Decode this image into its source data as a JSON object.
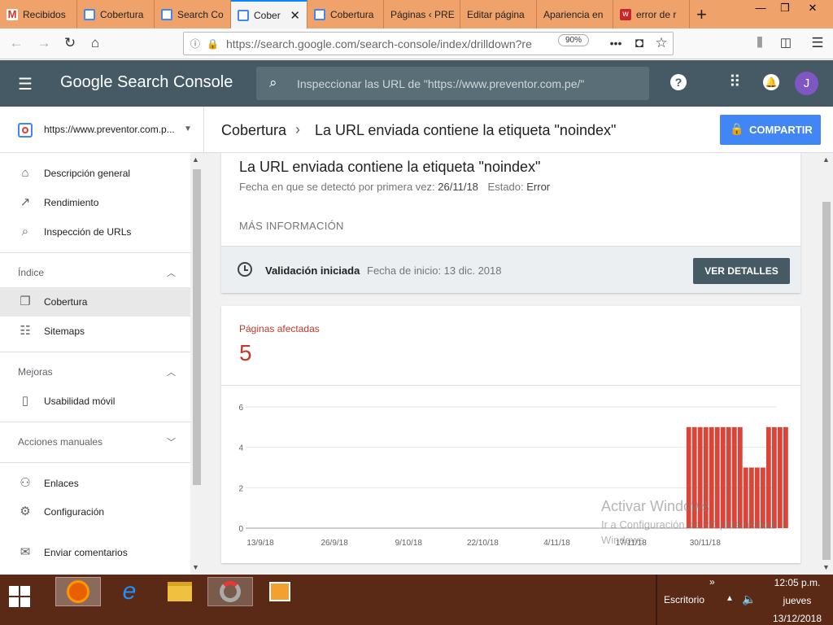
{
  "browser": {
    "tabs": [
      {
        "label": "Recibidos",
        "active": false
      },
      {
        "label": "Cobertura",
        "active": false
      },
      {
        "label": "Search Co",
        "active": false
      },
      {
        "label": "Cober",
        "active": true
      },
      {
        "label": "Cobertura",
        "active": false
      },
      {
        "label": "Páginas ‹ PRE",
        "active": false
      },
      {
        "label": "Editar página",
        "active": false
      },
      {
        "label": "Apariencia en",
        "active": false
      },
      {
        "label": "error de r",
        "active": false
      }
    ],
    "new_tab": "+",
    "url": "https://search.google.com/search-console/index/drilldown?re",
    "url_host": "search.google.com",
    "zoom": "90%"
  },
  "gsc": {
    "logo": "Google Search Console",
    "search_placeholder": "Inspeccionar las URL de \"https://www.preventor.com.pe/\"",
    "avatar_letter": "J",
    "property": "https://www.preventor.com.p...",
    "breadcrumb_parent": "Cobertura",
    "breadcrumb_current": "La URL enviada contiene la etiqueta \"noindex\"",
    "share_label": "COMPARTIR"
  },
  "sidebar": {
    "items_top": [
      {
        "label": "Descripción general",
        "icon": "home-icon"
      },
      {
        "label": "Rendimiento",
        "icon": "trending-up-icon"
      },
      {
        "label": "Inspección de URLs",
        "icon": "search-icon"
      }
    ],
    "section_index": "Índice",
    "items_index": [
      {
        "label": "Cobertura",
        "icon": "copy-icon"
      },
      {
        "label": "Sitemaps",
        "icon": "sitemap-icon"
      }
    ],
    "section_improve": "Mejoras",
    "items_improve": [
      {
        "label": "Usabilidad móvil",
        "icon": "phone-icon"
      }
    ],
    "section_manual": "Acciones manuales",
    "items_bottom": [
      {
        "label": "Enlaces",
        "icon": "links-icon"
      },
      {
        "label": "Configuración",
        "icon": "gear-icon"
      },
      {
        "label": "Enviar comentarios",
        "icon": "feedback-icon"
      }
    ]
  },
  "issue": {
    "title": "La URL enviada contiene la etiqueta \"noindex\"",
    "detected_label": "Fecha en que se detectó por primera vez:",
    "detected_date": "26/11/18",
    "status_label": "Estado:",
    "status_value": "Error",
    "more_info": "MÁS INFORMACIÓN",
    "validation_label": "Validación iniciada",
    "validation_date": "Fecha de inicio: 13 dic. 2018",
    "details_button": "VER DETALLES"
  },
  "affected": {
    "label": "Páginas afectadas",
    "count": "5"
  },
  "chart_data": {
    "type": "bar",
    "ylim": [
      0,
      6
    ],
    "yticks": [
      "0",
      "2",
      "4",
      "6"
    ],
    "xticks": [
      "13/9/18",
      "26/9/18",
      "9/10/18",
      "22/10/18",
      "4/11/18",
      "17/11/18",
      "30/11/18"
    ],
    "xtick_index": [
      0,
      13,
      26,
      39,
      52,
      65,
      78
    ],
    "start_index": 75,
    "values": [
      5,
      5,
      5,
      5,
      5,
      5,
      5,
      5,
      5,
      5,
      3,
      3,
      3,
      3,
      5,
      5,
      5,
      5
    ],
    "total_days": 93,
    "color": "#db4437"
  },
  "watermark": {
    "line1": "Activar Windows",
    "line2": "Ir a Configuración de PC para activar",
    "line3": "Windows."
  },
  "taskbar": {
    "desktop_label": "Escritorio",
    "time": "12:05 p.m.",
    "day": "jueves",
    "date": "13/12/2018"
  }
}
